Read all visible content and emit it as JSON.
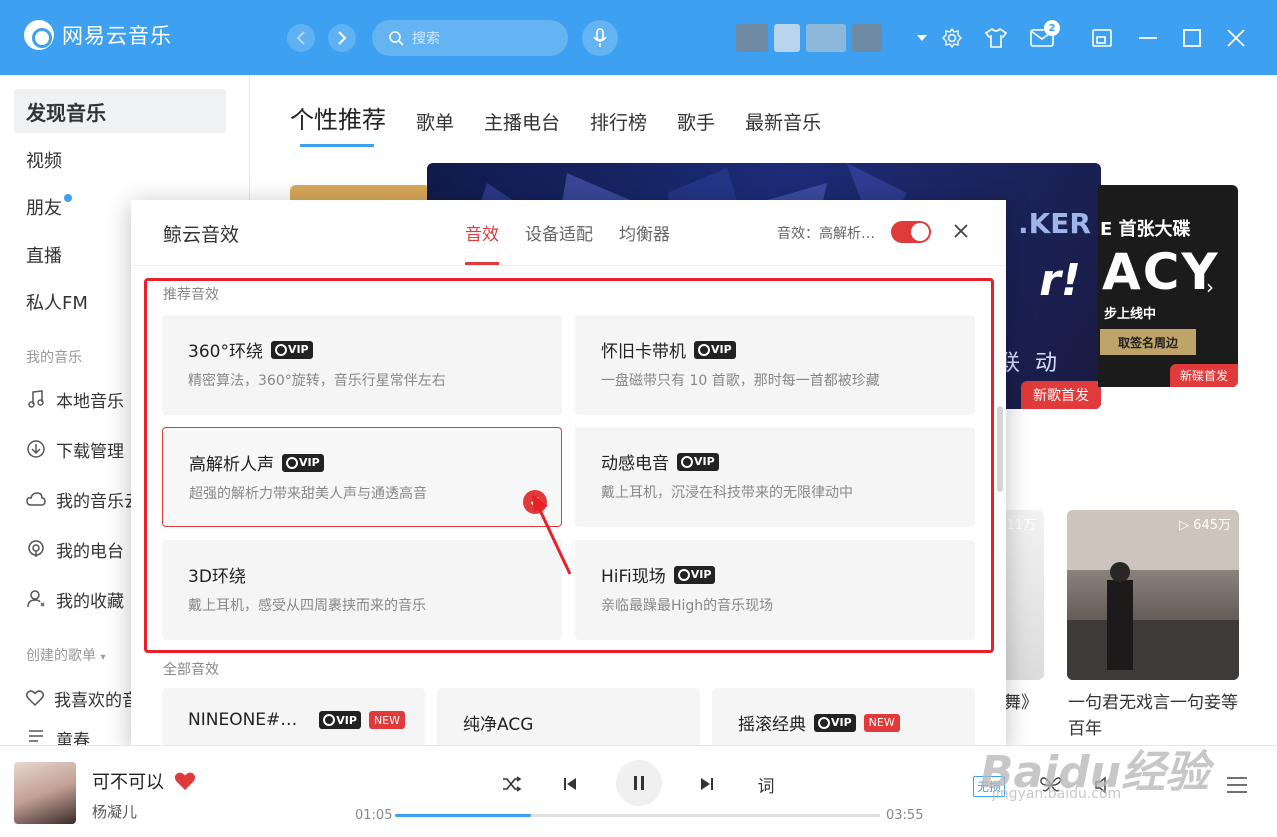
{
  "app": {
    "name": "网易云音乐",
    "search_placeholder": "搜索",
    "message_count": "2",
    "brand_color": "#3ea0f0",
    "accent_color": "#e03a3a"
  },
  "sidebar": {
    "items": [
      {
        "label": "发现音乐"
      },
      {
        "label": "视频"
      },
      {
        "label": "朋友"
      },
      {
        "label": "直播"
      },
      {
        "label": "私人FM"
      }
    ],
    "my_music_header": "我的音乐",
    "my_music": [
      {
        "label": "本地音乐",
        "icon": "music-note-icon"
      },
      {
        "label": "下载管理",
        "icon": "download-icon"
      },
      {
        "label": "我的音乐云",
        "icon": "cloud-icon"
      },
      {
        "label": "我的电台",
        "icon": "radio-icon"
      },
      {
        "label": "我的收藏",
        "icon": "favorites-icon"
      }
    ],
    "created_header": "创建的歌单",
    "created": [
      {
        "label": "我喜欢的音乐",
        "icon": "heart-icon"
      },
      {
        "label": "童春",
        "icon": "playlist-icon"
      }
    ]
  },
  "main": {
    "tabs": [
      "个性推荐",
      "歌单",
      "主播电台",
      "排行榜",
      "歌手",
      "最新音乐"
    ],
    "banner": {
      "tag_main": "新歌首发",
      "ker_text": ".KER",
      "big_text": "r!",
      "liandong": "联 动",
      "right_title": "E 首张大碟",
      "right_big": "ACY",
      "right_sub": "步上线中",
      "right_btn": "取签名周边",
      "tag_right": "新碟首发"
    },
    "playlists": [
      {
        "count": "11万",
        "name": "舞》"
      },
      {
        "count": "▷ 645万",
        "name": "一句君无戏言一句妾等百年"
      }
    ]
  },
  "modal": {
    "title": "鲸云音效",
    "tabs": [
      "音效",
      "设备适配",
      "均衡器"
    ],
    "fx_label": "音效：高解析…",
    "recommended_label": "推荐音效",
    "all_label": "全部音效",
    "vip_text": "VIP",
    "recommended": [
      {
        "name": "360°环绕",
        "desc": "精密算法，360°旋转，音乐行星常伴左右"
      },
      {
        "name": "怀旧卡带机",
        "desc": "一盘磁带只有 10 首歌，那时每一首都被珍藏"
      },
      {
        "name": "高解析人声",
        "desc": "超强的解析力带来甜美人声与通透高音"
      },
      {
        "name": "动感电音",
        "desc": "戴上耳机，沉浸在科技带来的无限律动中"
      },
      {
        "name": "3D环绕",
        "desc": "戴上耳机，感受从四周裹挟而来的音乐"
      },
      {
        "name": "HiFi现场",
        "desc": "亲临最躁最High的音乐现场"
      }
    ],
    "all": [
      {
        "name": "NINEONE#…",
        "new": "NEW"
      },
      {
        "name": "纯净ACG"
      },
      {
        "name": "摇滚经典",
        "new": "NEW"
      }
    ]
  },
  "player": {
    "song": "可不可以",
    "artist": "杨凝儿",
    "current_time": "01:05",
    "total_time": "03:55",
    "progress": 0.28,
    "lyrics_label": "词",
    "lossless_label": "无损"
  },
  "watermark": {
    "text": "Baidu经验",
    "sub": "jingyan.baidu.com"
  }
}
